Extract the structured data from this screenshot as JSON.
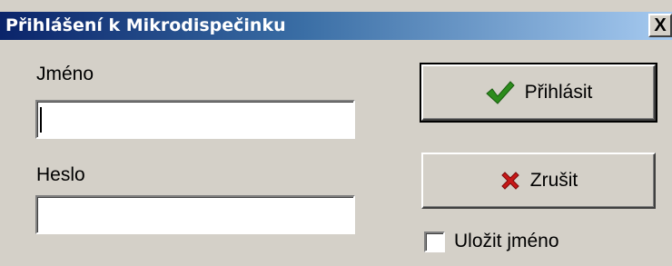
{
  "window": {
    "title": "Přihlášení k Mikrodispečinku",
    "close_glyph": "X"
  },
  "form": {
    "name_label": "Jméno",
    "name_value": "",
    "password_label": "Heslo",
    "password_value": ""
  },
  "buttons": {
    "login_label": "Přihlásit",
    "cancel_label": "Zrušit"
  },
  "options": {
    "save_name_label": "Uložit jméno",
    "save_name_checked": false
  },
  "colors": {
    "check_green": "#2c8c1c",
    "cross_red": "#c81818",
    "face": "#d4d0c8"
  }
}
